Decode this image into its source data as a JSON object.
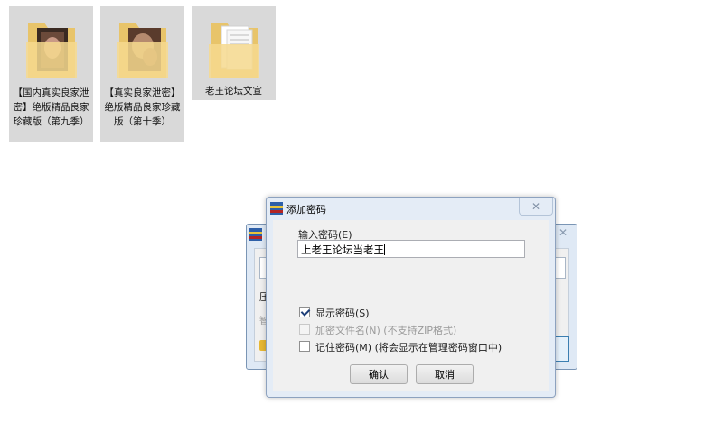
{
  "desktop": {
    "folders": [
      {
        "label": "【国内真实良家泄密】绝版精品良家珍藏版（第九季）",
        "selected": true
      },
      {
        "label": "【真实良家泄密】绝版精品良家珍藏版（第十季）",
        "selected": true
      },
      {
        "label": "老王论坛文宣",
        "selected": true
      }
    ]
  },
  "background_dialog": {
    "text1": "压",
    "text2": "智"
  },
  "password_dialog": {
    "title": "添加密码",
    "close_symbol": "✕",
    "password_label": "输入密码(E)",
    "password_value": "上老王论坛当老王",
    "options": [
      {
        "label": "显示密码(S)",
        "checked": true,
        "enabled": true
      },
      {
        "label": "加密文件名(N) (不支持ZIP格式)",
        "checked": false,
        "enabled": false
      },
      {
        "label": "记住密码(M) (将会显示在管理密码窗口中)",
        "checked": false,
        "enabled": true
      }
    ],
    "ok_label": "确认",
    "cancel_label": "取消"
  }
}
